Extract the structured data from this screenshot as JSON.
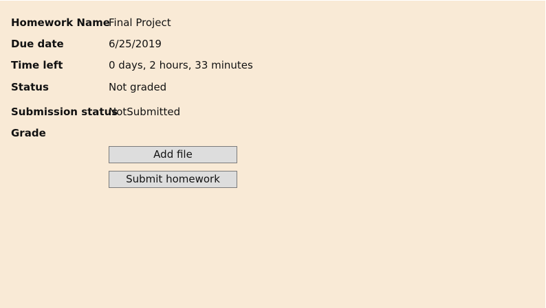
{
  "homework": {
    "name_label": "Homework Name",
    "name_value": "Final Project",
    "due_label": "Due date",
    "due_value": "6/25/2019",
    "time_left_label": "Time left",
    "time_left_value": "0 days, 2 hours, 33 minutes",
    "status_label": "Status",
    "status_value": "Not graded",
    "submission_status_label": "Submission status",
    "submission_status_value": "NotSubmitted",
    "grade_label": "Grade",
    "grade_value": ""
  },
  "actions": {
    "add_file_label": "Add file",
    "submit_label": "Submit homework"
  },
  "colors": {
    "background": "#f9ead6",
    "button_bg": "#dddddd",
    "button_border": "#7a7a7a"
  }
}
